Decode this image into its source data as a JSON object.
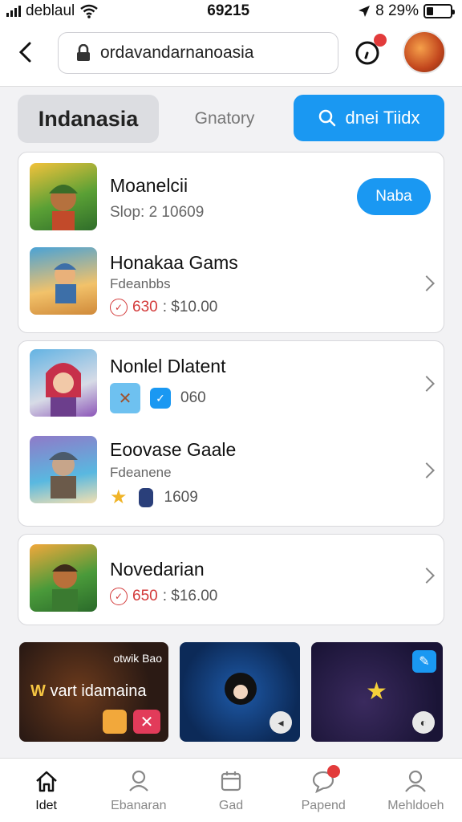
{
  "status": {
    "carrier": "deblaul",
    "time": "69215",
    "battery": "8 29%",
    "battery_level": 0.29
  },
  "urlbar": {
    "url": "ordavandarnanoasia"
  },
  "tabs": {
    "active": "Indanasia",
    "other": "Gnatory",
    "search": "dnei Tiidx"
  },
  "cards": [
    {
      "rows": [
        {
          "title": "Moanelcii",
          "subtitle": "Slop: 2 10609",
          "action": "Naba"
        },
        {
          "title": "Honakaa Gams",
          "subtitle": "Fdeanbbs",
          "price_red": "630",
          "price": ": $10.00"
        }
      ]
    },
    {
      "rows": [
        {
          "title": "Nonlel Dlatent",
          "meta": "060"
        },
        {
          "title": "Eoovase Gaale",
          "subtitle": "Fdeanene",
          "meta": "1609"
        }
      ]
    },
    {
      "rows": [
        {
          "title": "Novedarian",
          "price_red": "650",
          "price": ": $16.00"
        }
      ]
    }
  ],
  "banners": [
    {
      "tag": "otwik Bao",
      "title_w": "W",
      "title": "vart idamaina"
    },
    {
      "tag": ""
    },
    {
      "tag": ""
    }
  ],
  "nav": [
    {
      "label": "Idet",
      "icon": "home-icon"
    },
    {
      "label": "Ebanaran",
      "icon": "user-icon"
    },
    {
      "label": "Gad",
      "icon": "calendar-icon"
    },
    {
      "label": "Papend",
      "icon": "chat-icon"
    },
    {
      "label": "Mehldoeh",
      "icon": "profile-icon"
    }
  ],
  "colors": {
    "accent": "#1a98f2",
    "badge": "#e23b3b",
    "price_red": "#d33a3a"
  }
}
